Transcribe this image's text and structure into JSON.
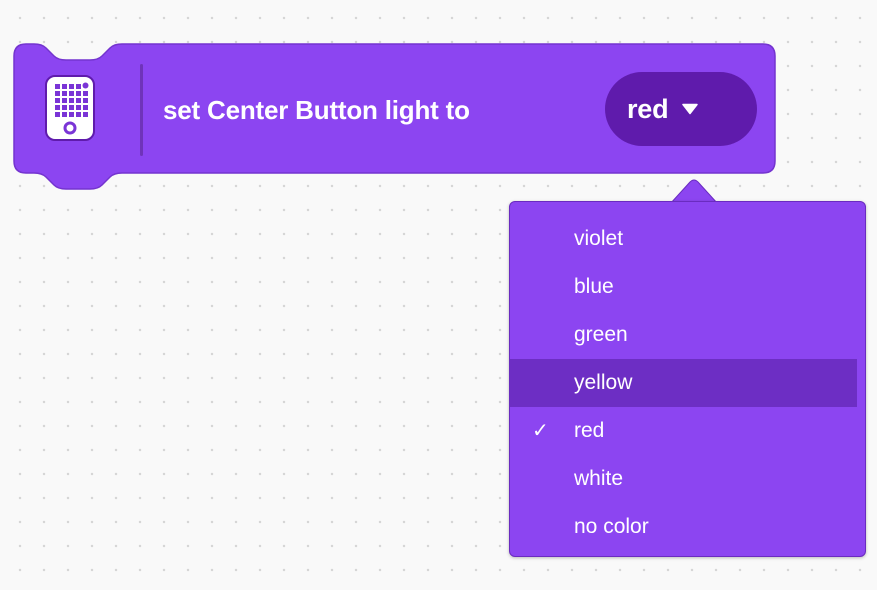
{
  "block": {
    "label": "set Center Button light to",
    "icon": "hub-matrix-icon",
    "color_field": {
      "value": "red",
      "caret_icon": "triangle-down-icon"
    },
    "fill_color": "#8c45f1",
    "dark_color": "#5f1bac"
  },
  "dropdown": {
    "options": [
      {
        "label": "violet"
      },
      {
        "label": "blue"
      },
      {
        "label": "green"
      },
      {
        "label": "yellow"
      },
      {
        "label": "red"
      },
      {
        "label": "white"
      },
      {
        "label": "no color"
      }
    ],
    "selected": "red",
    "hovered": "yellow",
    "check_mark": "✓"
  }
}
